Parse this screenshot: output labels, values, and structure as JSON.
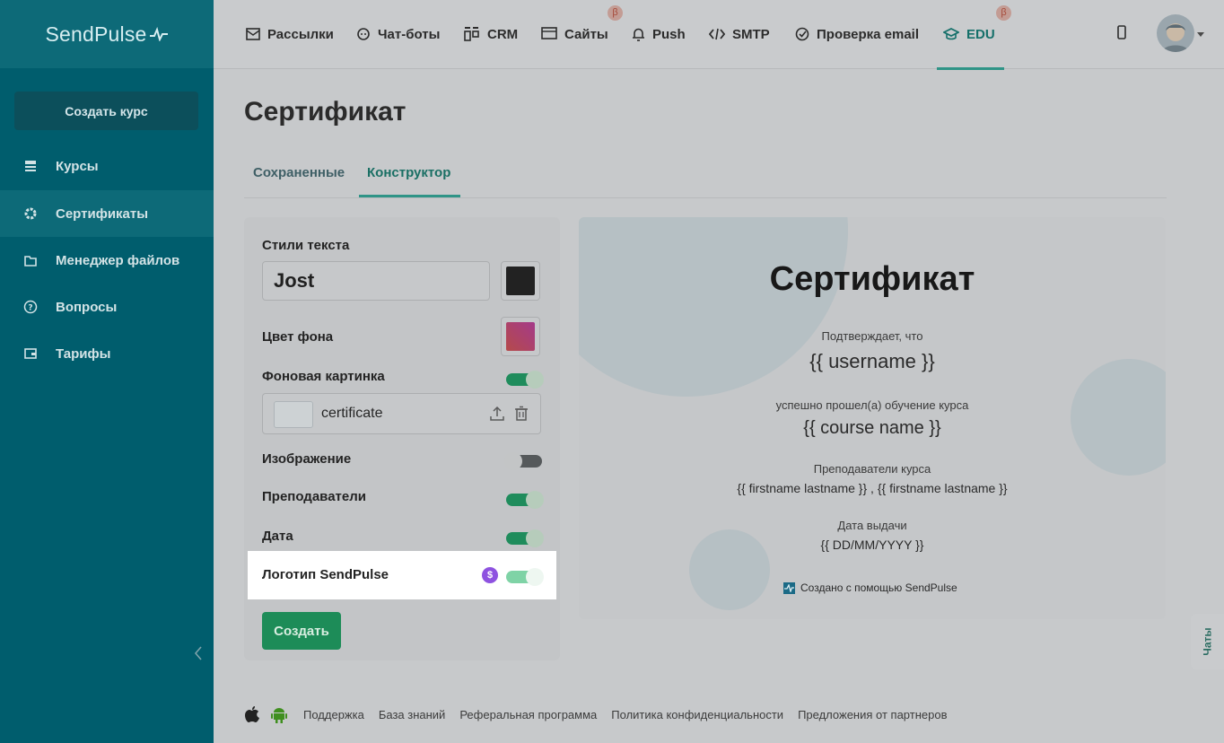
{
  "brand": {
    "name": "SendPulse"
  },
  "sidebar": {
    "create_button": "Создать курс",
    "items": [
      {
        "label": "Курсы",
        "icon": "courses-icon"
      },
      {
        "label": "Сертификаты",
        "icon": "gear-icon",
        "active": true
      },
      {
        "label": "Менеджер файлов",
        "icon": "folder-icon"
      },
      {
        "label": "Вопросы",
        "icon": "question-icon"
      },
      {
        "label": "Тарифы",
        "icon": "wallet-icon"
      }
    ]
  },
  "topnav": {
    "items": [
      {
        "label": "Рассылки",
        "icon": "mail-icon"
      },
      {
        "label": "Чат-боты",
        "icon": "chat-icon"
      },
      {
        "label": "CRM",
        "icon": "crm-icon"
      },
      {
        "label": "Сайты",
        "icon": "site-icon",
        "beta": "β"
      },
      {
        "label": "Push",
        "icon": "bell-icon"
      },
      {
        "label": "SMTP",
        "icon": "code-icon"
      },
      {
        "label": "Проверка email",
        "icon": "check-icon"
      },
      {
        "label": "EDU",
        "icon": "edu-icon",
        "active": true,
        "beta": "β"
      }
    ]
  },
  "page": {
    "title": "Сертификат",
    "tabs": [
      {
        "label": "Сохраненные"
      },
      {
        "label": "Конструктор",
        "active": true
      }
    ]
  },
  "settings": {
    "text_styles_label": "Стили текста",
    "font_value": "Jost",
    "text_color": "#222222",
    "bg_color_label": "Цвет фона",
    "bg_image_label": "Фоновая картинка",
    "bg_image_enabled": true,
    "bg_image_name": "certificate",
    "image_label": "Изображение",
    "image_enabled": false,
    "teachers_label": "Преподаватели",
    "teachers_enabled": true,
    "date_label": "Дата",
    "date_enabled": true,
    "logo_label": "Логотип SendPulse",
    "logo_enabled": true,
    "logo_badge": "$",
    "create_button": "Создать"
  },
  "certificate": {
    "title": "Сертификат",
    "confirms": "Подтверждает, что",
    "username": "{{ username }}",
    "completed": "успешно прошел(а) обучение курса",
    "course": "{{ course name }}",
    "teachers_caption": "Преподаватели курса",
    "teachers": "{{ firstname lastname }} , {{ firstname lastname }}",
    "date_caption": "Дата выдачи",
    "date": "{{ DD/MM/YYYY }}",
    "made_with": "Создано с помощью SendPulse"
  },
  "chats_tab": "Чаты",
  "footer": {
    "links": [
      "Поддержка",
      "База знаний",
      "Реферальная программа",
      "Политика конфиденциальности",
      "Предложения от партнеров"
    ]
  },
  "colors": {
    "sidebar": "#005d6d",
    "accent_green": "#1d8c58",
    "active_nav": "#15706a"
  }
}
